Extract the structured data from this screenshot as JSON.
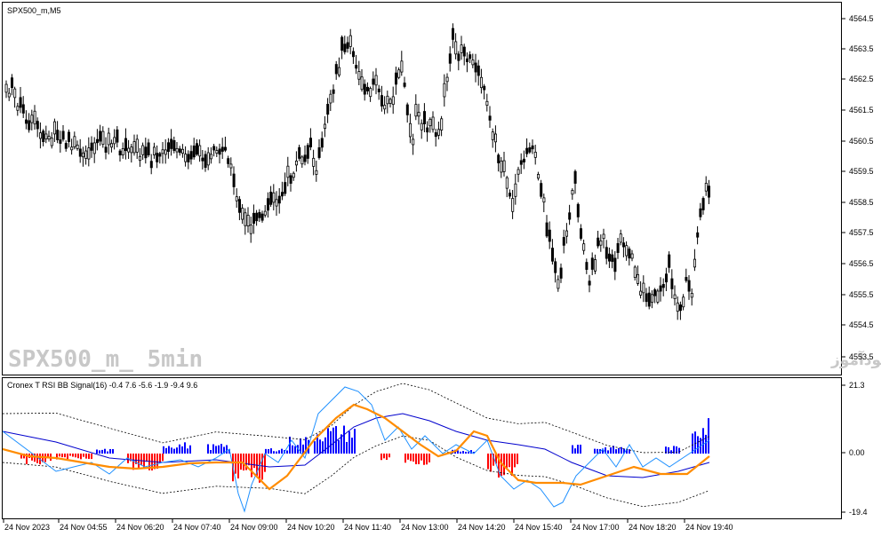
{
  "chart": {
    "symbol_title": "SPX500_m,M5",
    "watermark_left": "SPX500_m_ 5min",
    "watermark_right": "انتشار در سایت سودآموز",
    "price_axis_labels": [
      "4564.5",
      "4563.5",
      "4562.5",
      "4561.5",
      "4560.5",
      "4559.5",
      "4558.5",
      "4557.5",
      "4556.5",
      "4555.5",
      "4554.5",
      "4553.5"
    ],
    "time_axis_labels": [
      "24 Nov 2023",
      "24 Nov 04:55",
      "24 Nov 06:20",
      "24 Nov 07:40",
      "24 Nov 09:00",
      "24 Nov 10:20",
      "24 Nov 11:40",
      "24 Nov 13:00",
      "24 Nov 14:20",
      "24 Nov 15:40",
      "24 Nov 17:00",
      "24 Nov 18:20",
      "24 Nov 19:40"
    ]
  },
  "indicator": {
    "title": "Cronex T RSI BB Signal(16) -0.4 7.6 -5.6 -1.9 -9.4 9.6",
    "axis_labels": [
      "21.3",
      "0.00",
      "-19.4"
    ],
    "colors": {
      "positive_bar": "#0000ff",
      "negative_bar": "#ff0000",
      "signal_line": "#ff8c00",
      "rsi_line": "#1e90ff",
      "mid_band": "#0000cd",
      "bands": "#000000"
    }
  }
}
